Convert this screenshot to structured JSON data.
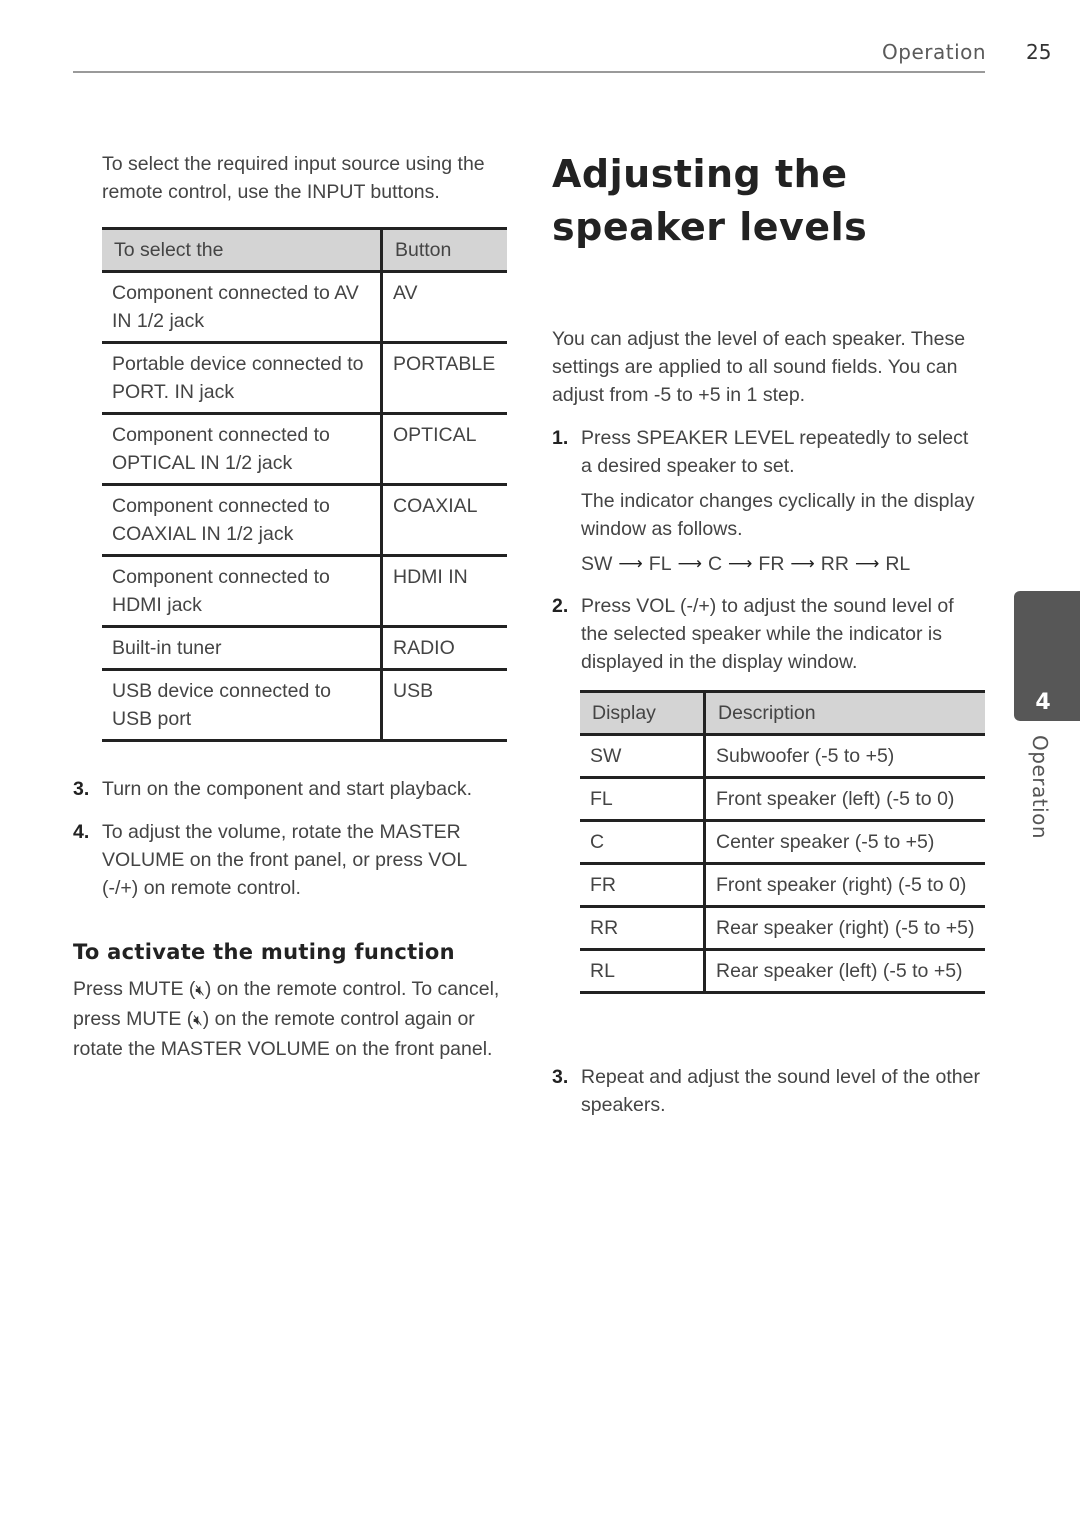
{
  "header": {
    "section": "Operation",
    "page_number": "25"
  },
  "left": {
    "intro": "To select the required input source using the remote control, use the INPUT buttons.",
    "input_table": {
      "headers": [
        "To select the",
        "Button"
      ],
      "rows": [
        [
          "Component connected to AV IN 1/2 jack",
          "AV"
        ],
        [
          "Portable device connected to PORT. IN jack",
          "PORTABLE"
        ],
        [
          "Component connected to OPTICAL IN 1/2 jack",
          "OPTICAL"
        ],
        [
          "Component connected to COAXIAL IN 1/2 jack",
          "COAXIAL"
        ],
        [
          "Component connected to HDMI jack",
          "HDMI IN"
        ],
        [
          "Built-in tuner",
          "RADIO"
        ],
        [
          "USB device connected to USB port",
          "USB"
        ]
      ]
    },
    "steps": [
      {
        "num": "3.",
        "text": "Turn on the component and start playback."
      },
      {
        "num": "4.",
        "text": "To adjust the volume, rotate the MASTER VOLUME on the front panel, or press VOL (-/+) on remote control."
      }
    ],
    "muting": {
      "heading": "To activate the muting function",
      "part1": "Press MUTE (",
      "part2": ") on the remote control. To cancel, press MUTE (",
      "part3": ") on the remote control again or rotate the MASTER VOLUME on the front panel.",
      "icon": "mute-icon",
      "glyph": "🔇︎"
    }
  },
  "right": {
    "title": "Adjusting the speaker levels",
    "intro": "You can adjust the level of each speaker. These settings are applied to all sound fields. You can adjust from -5 to +5 in 1 step.",
    "step1": {
      "num": "1.",
      "text": "Press SPEAKER LEVEL repeatedly to select a desired speaker to set."
    },
    "indicator_text": "The indicator changes cyclically in the display window as follows.",
    "sequence": [
      "SW",
      "FL",
      "C",
      "FR",
      "RR",
      "RL"
    ],
    "arrow_glyph": "⟶",
    "step2": {
      "num": "2.",
      "text": "Press VOL (-/+) to adjust the sound level of the selected speaker while the indicator is displayed in the display window."
    },
    "speaker_table": {
      "headers": [
        "Display",
        "Description"
      ],
      "rows": [
        [
          "SW",
          "Subwoofer (-5 to +5)"
        ],
        [
          "FL",
          "Front speaker (left) (-5 to 0)"
        ],
        [
          "C",
          "Center speaker (-5 to +5)"
        ],
        [
          "FR",
          "Front speaker (right) (-5 to 0)"
        ],
        [
          "RR",
          "Rear speaker (right) (-5 to +5)"
        ],
        [
          "RL",
          "Rear speaker (left) (-5 to +5)"
        ]
      ]
    },
    "step3": {
      "num": "3.",
      "text": "Repeat and adjust the sound level of the other speakers."
    }
  },
  "side_tab": {
    "number": "4",
    "label": "Operation"
  }
}
